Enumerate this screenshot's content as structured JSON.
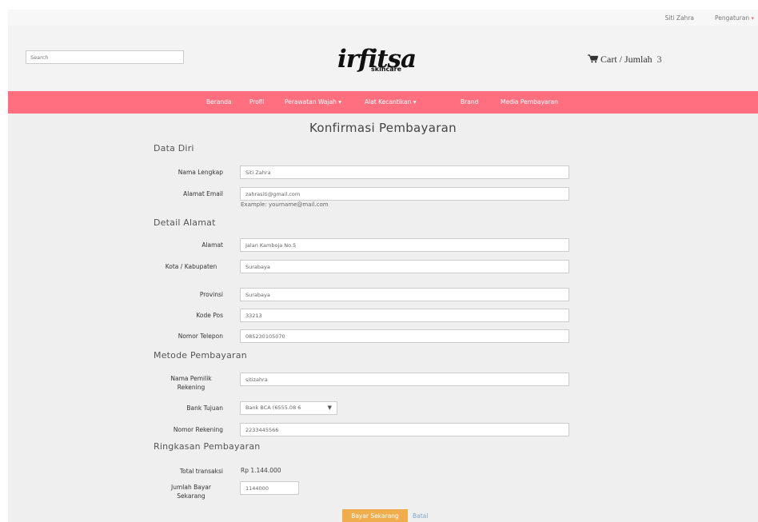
{
  "topbar": {
    "user_name": "Siti Zahra",
    "settings_label": "Pengaturan",
    "caret": "▾"
  },
  "header": {
    "search_placeholder": "Search",
    "logo_script": "irfitsa",
    "logo_sub": "skincare",
    "cart_label": "Cart / Jumlah",
    "cart_count": "3"
  },
  "nav": {
    "items": [
      {
        "label": "Beranda"
      },
      {
        "label": "Profil"
      },
      {
        "label": "Perawatan Wajah ▾"
      },
      {
        "label": "Alat Kecantikan ▾"
      },
      {
        "label": "Brand"
      },
      {
        "label": "Media Pembayaran"
      }
    ]
  },
  "page": {
    "title": "Konfirmasi Pembayaran"
  },
  "sections": {
    "data_diri": "Data Diri",
    "detail_alamat": "Detail Alamat",
    "metode_pembayaran": "Metode Pembayaran",
    "ringkasan": "Ringkasan Pembayaran"
  },
  "form": {
    "nama_lengkap": {
      "label": "Nama Lengkap",
      "value": "Siti Zahra"
    },
    "alamat_email": {
      "label": "Alamat Email",
      "value": "zahrasiti@gmail.com",
      "help": "Example: yourname@mail.com"
    },
    "alamat": {
      "label": "Alamat",
      "value": "Jalan Kamboja No.5"
    },
    "kota": {
      "label": "Kota / Kabupaten",
      "value": "Surabaya"
    },
    "provinsi": {
      "label": "Provinsi",
      "value": "Surabaya"
    },
    "kode_pos": {
      "label": "Kode Pos",
      "value": "33213"
    },
    "nomor_telepon": {
      "label": "Nomor Telepon",
      "value": "085230105070"
    },
    "nama_pemilik": {
      "label": "Nama Pemilik Rekening",
      "value": "sitizahra"
    },
    "bank_tujuan": {
      "label": "Bank Tujuan",
      "value": "Bank BCA (6555.08 6"
    },
    "nomor_rekening": {
      "label": "Nomor Rekening",
      "value": "2233445566"
    }
  },
  "summary": {
    "total_label": "Total transaksi",
    "total_value": "Rp 1.144.000",
    "bayar_label": "Jumlah Bayar Sekarang",
    "bayar_value": "1144000"
  },
  "actions": {
    "pay_label": "Bayar Sekarang",
    "cancel_label": "Batal"
  },
  "colors": {
    "nav_bg": "#ff6f7f",
    "pay_button": "#f0ad4e",
    "cancel_link": "#7fa8c8"
  }
}
